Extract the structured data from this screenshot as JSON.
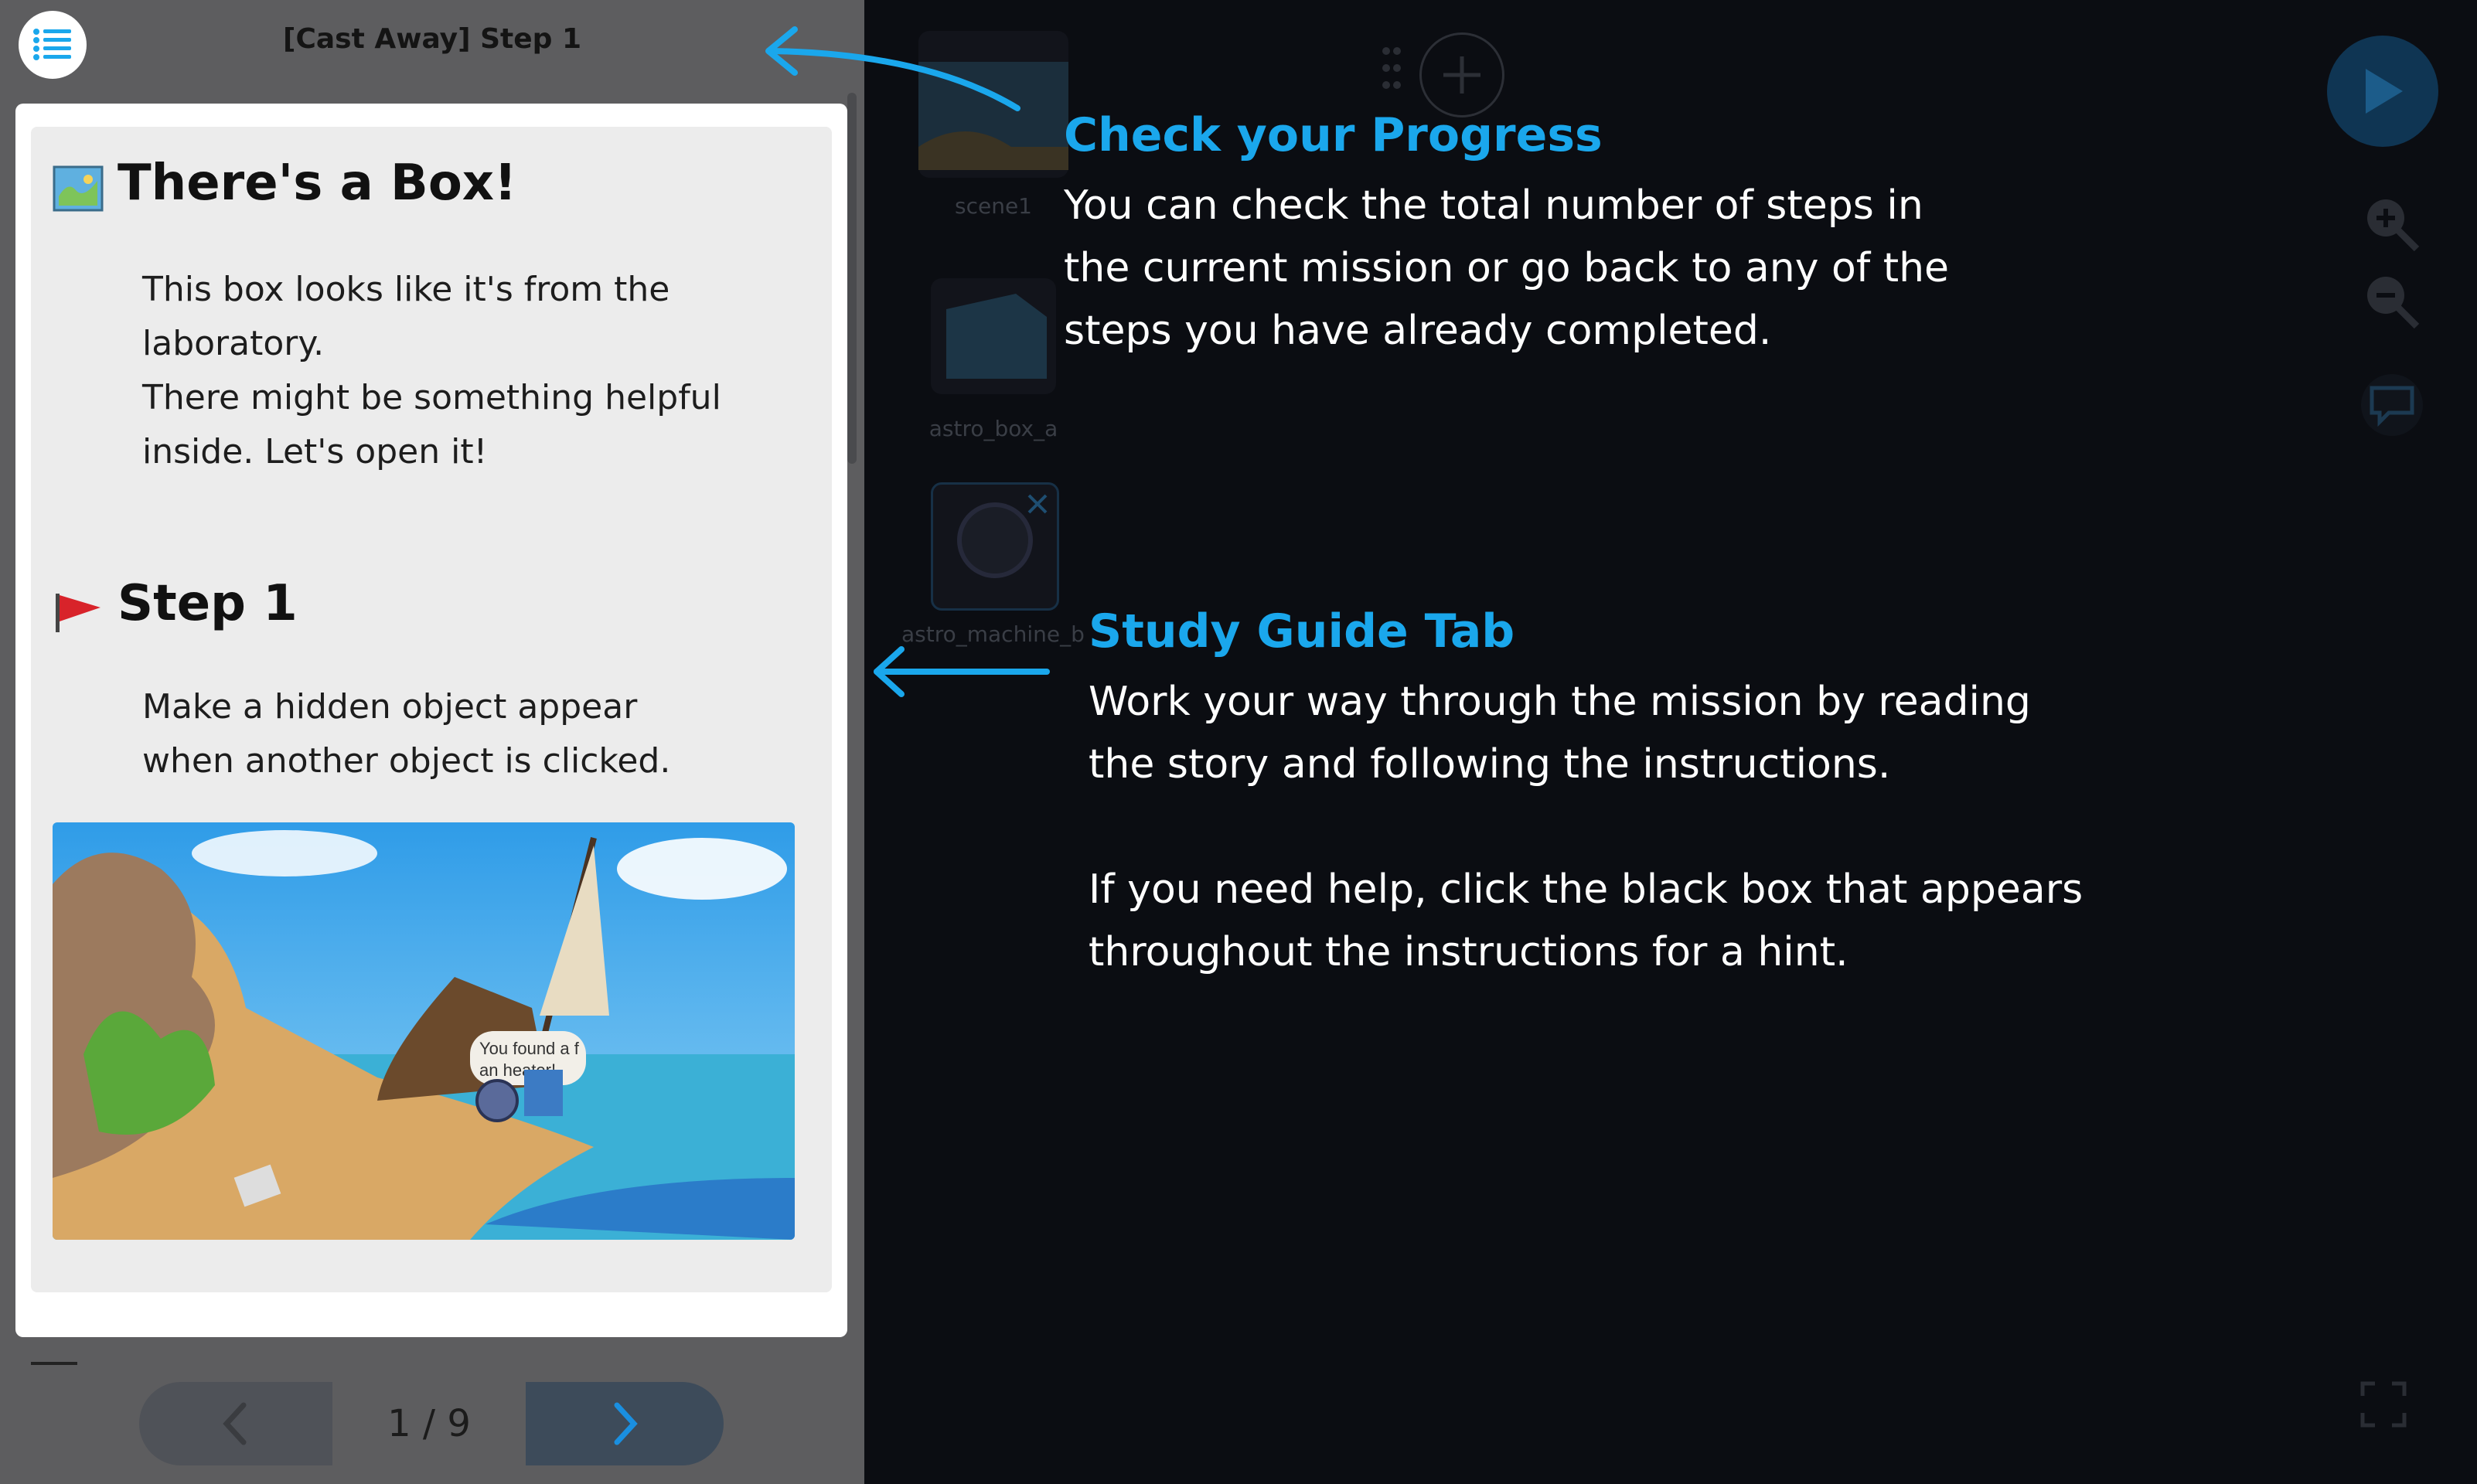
{
  "panel": {
    "title": "[Cast Away] Step 1",
    "heading1_icon": "map-icon",
    "heading1": "There's a Box!",
    "story_lines": [
      "This box looks like it's from the",
      "laboratory.",
      "There might be something helpful",
      "inside. Let's open it!"
    ],
    "heading2_icon": "red-flag-icon",
    "heading2": "Step 1",
    "step_lines": [
      "Make a hidden object appear",
      "when another object is clicked."
    ],
    "image": {
      "bubble_line1": "You found a f",
      "bubble_line2": "an heater!"
    },
    "pager": {
      "text": "1 / 9"
    }
  },
  "assets": [
    {
      "label": "scene1"
    },
    {
      "label": "astro_box_a"
    },
    {
      "label": "astro_machine_b"
    }
  ],
  "callouts": {
    "progress": {
      "title": "Check your Progress",
      "lines": [
        "You can check the total number of steps in",
        "the current mission or go back to any of the",
        "steps you have already completed."
      ]
    },
    "guide": {
      "title": "Study Guide Tab",
      "lines": [
        "Work your way through the mission by reading",
        "the story and following the instructions."
      ],
      "lines2": [
        "If you need help, click the black box that appears",
        "throughout the instructions for a hint."
      ]
    }
  },
  "toolbar": {
    "icons": [
      "play-icon",
      "zoom-in-icon",
      "zoom-out-icon",
      "help-chat-icon",
      "fullscreen-icon",
      "add-icon"
    ]
  },
  "colors": {
    "accent": "#1aa7ec",
    "panel_bg": "#5d5d5f",
    "editor_bg": "#0b0d12"
  }
}
